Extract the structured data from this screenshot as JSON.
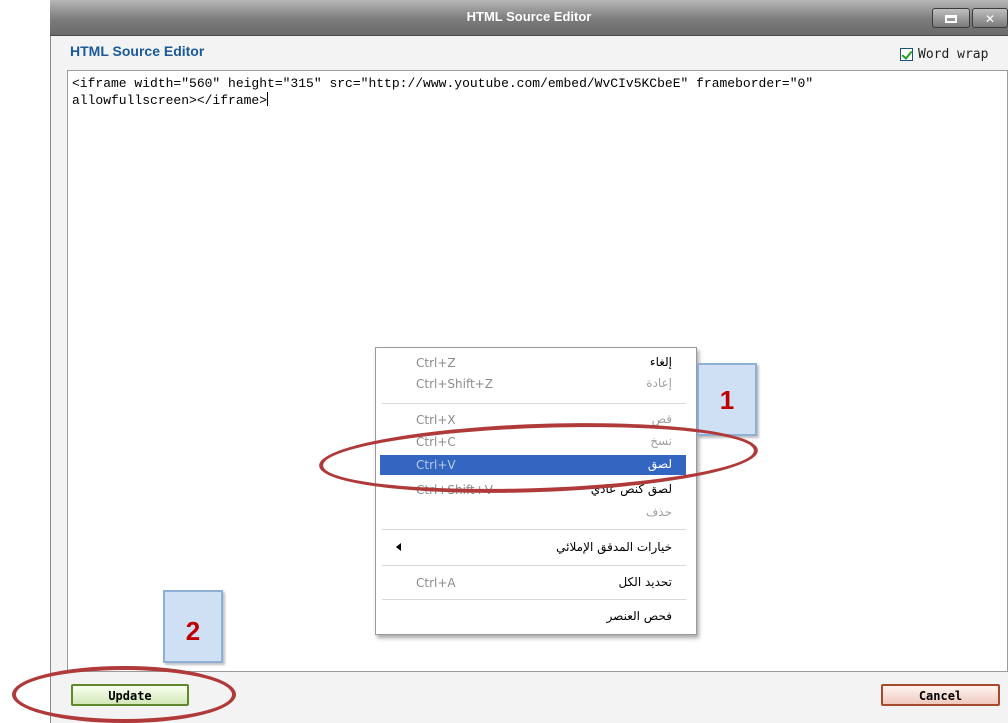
{
  "window": {
    "title": "HTML Source Editor",
    "maximize_icon": "maximize-icon",
    "close_icon": "close-icon",
    "close_glyph": "✕"
  },
  "editor": {
    "heading": "HTML Source Editor",
    "word_wrap": {
      "label": "Word wrap",
      "checked": true
    },
    "content_line1": "<iframe width=\"560\" height=\"315\" src=\"http://www.youtube.com/embed/WvCIv5KCbeE\" frameborder=\"0\"",
    "content_line2": "allowfullscreen></iframe>"
  },
  "context_menu": {
    "items": [
      {
        "label": "إلغاء",
        "shortcut": "Ctrl+Z"
      },
      {
        "label": "إعادة",
        "shortcut": "Ctrl+Shift+Z"
      },
      {
        "label": "قص",
        "shortcut": "Ctrl+X"
      },
      {
        "label": "نسخ",
        "shortcut": "Ctrl+C"
      },
      {
        "label": "لصق",
        "shortcut": "Ctrl+V"
      },
      {
        "label": "لصق كنص عادي",
        "shortcut": "Ctrl+Shift+V"
      },
      {
        "label": "حذف",
        "shortcut": ""
      },
      {
        "label": "خيارات المدقق الإملائي",
        "shortcut": ""
      },
      {
        "label": "تحديد الكل",
        "shortcut": "Ctrl+A"
      },
      {
        "label": "فحص العنصر",
        "shortcut": ""
      }
    ],
    "selected_item": "لصق"
  },
  "annotations": {
    "step1": "1",
    "step2": "2",
    "highlight_color": "#b03a3a"
  },
  "buttons": {
    "update": "Update",
    "cancel": "Cancel"
  }
}
